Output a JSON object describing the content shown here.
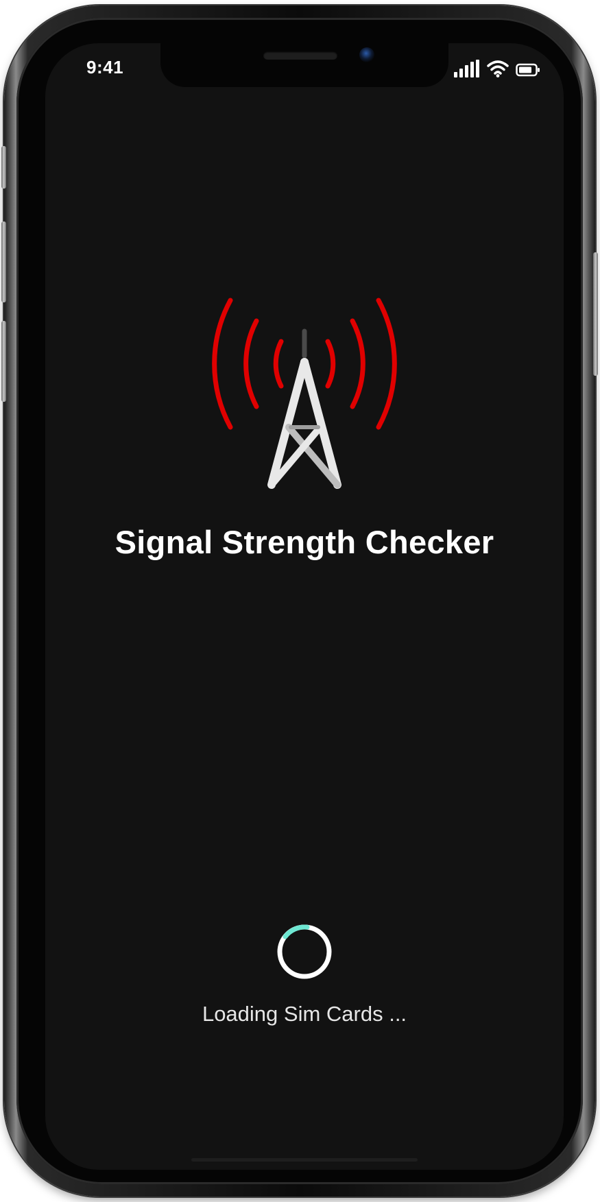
{
  "status_bar": {
    "time": "9:41",
    "icons": [
      "cellular-signal-icon",
      "wifi-icon",
      "battery-icon"
    ]
  },
  "app": {
    "title": "Signal Strength Checker",
    "logo_icon": "radio-tower-icon",
    "loading_text": "Loading Sim Cards ..."
  },
  "colors": {
    "background": "#121212",
    "signal_waves": "#e00000",
    "tower": "#e8e8e8",
    "spinner_ring": "#ffffff",
    "spinner_accent": "#6ee7d2"
  }
}
